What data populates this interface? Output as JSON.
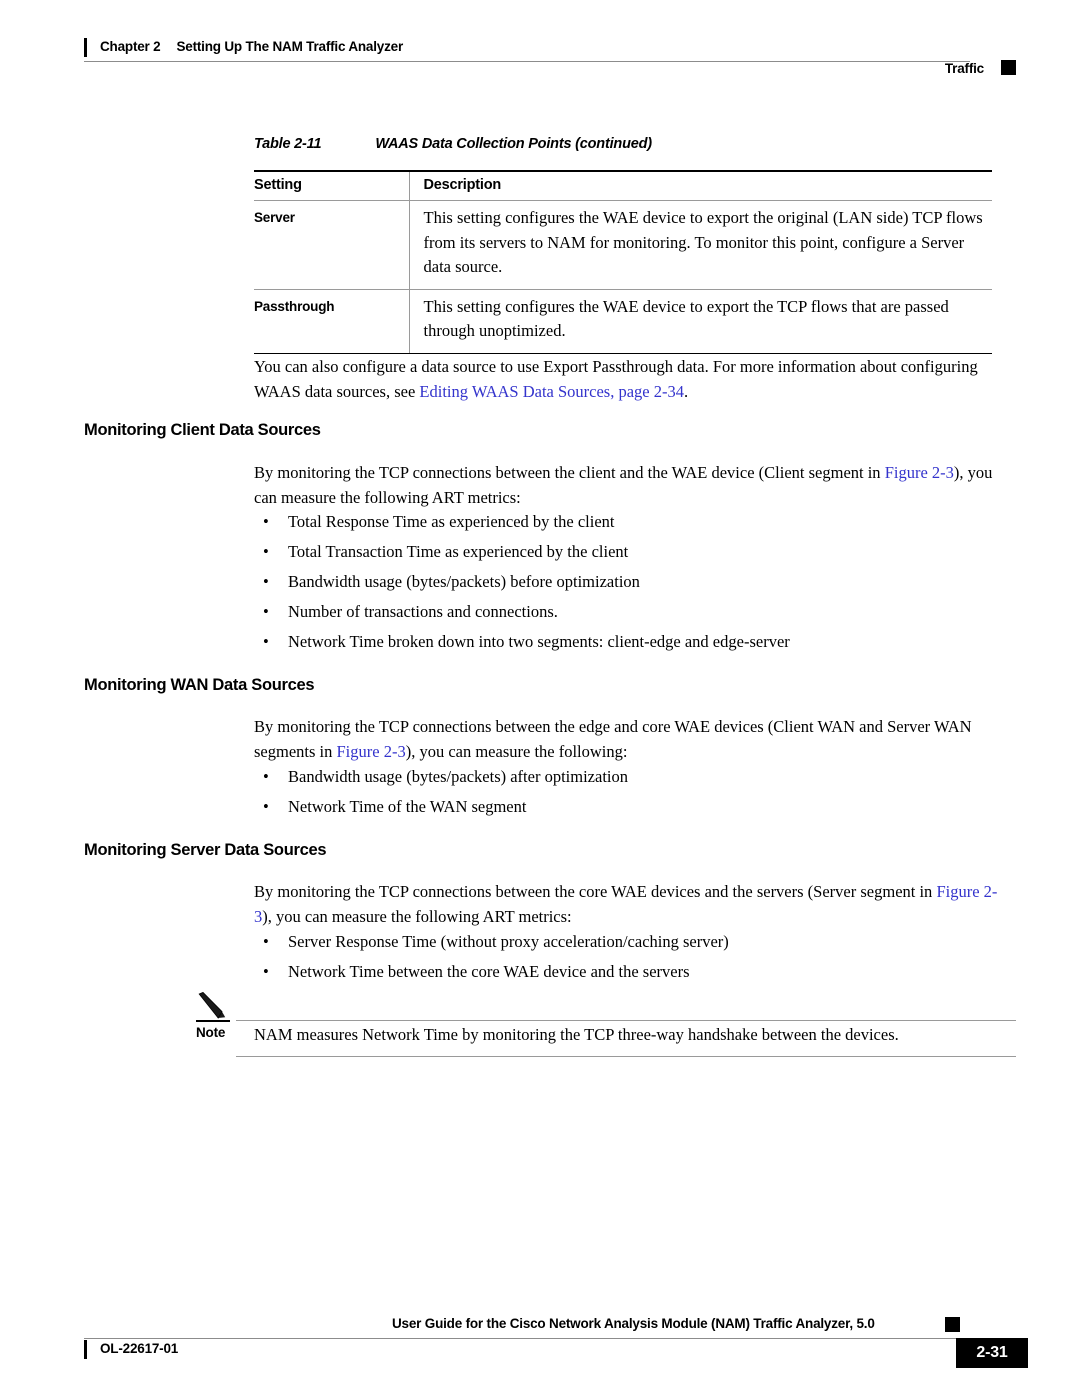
{
  "header": {
    "chapter": "Chapter 2",
    "chapter_title": "Setting Up The NAM Traffic Analyzer",
    "right_label": "Traffic"
  },
  "table": {
    "caption_number": "Table 2-11",
    "caption_title": "WAAS Data Collection Points  (continued)",
    "columns": [
      "Setting",
      "Description"
    ],
    "rows": [
      {
        "setting": "Server",
        "description": "This setting configures the WAE device to export the original (LAN side) TCP flows from its servers to NAM for monitoring. To monitor this point, configure a Server data source."
      },
      {
        "setting": "Passthrough",
        "description": "This setting configures the WAE device to export the TCP flows that are passed through unoptimized."
      }
    ]
  },
  "intro_para": {
    "text_before": "You can also configure a data source to use Export Passthrough data. For more information about configuring WAAS data sources, see ",
    "link": "Editing WAAS Data Sources, page 2-34",
    "text_after": "."
  },
  "sections": [
    {
      "heading": "Monitoring Client Data Sources",
      "para_before": "By monitoring the TCP connections between the client and the WAE device (Client segment in ",
      "para_link": "Figure 2-3",
      "para_after": "), you can measure the following ART metrics:",
      "bullets": [
        "Total Response Time as experienced by the client",
        "Total Transaction Time as experienced by the client",
        "Bandwidth usage (bytes/packets) before optimization",
        "Number of transactions and connections.",
        "Network Time broken down into two segments: client-edge and edge-server"
      ]
    },
    {
      "heading": "Monitoring WAN Data Sources",
      "para_before": "By monitoring the TCP connections between the edge and core WAE devices (Client WAN and Server WAN segments in ",
      "para_link": "Figure 2-3",
      "para_after": "), you can measure the following:",
      "bullets": [
        "Bandwidth usage (bytes/packets) after optimization",
        "Network Time of the WAN segment"
      ]
    },
    {
      "heading": "Monitoring Server Data Sources",
      "para_before": "By monitoring the TCP connections between the core WAE devices and the servers (Server segment in ",
      "para_link": "Figure 2-3",
      "para_after": "), you can measure the following ART metrics:",
      "bullets": [
        "Server Response Time (without proxy acceleration/caching server)",
        "Network Time between the core WAE device and the servers"
      ]
    }
  ],
  "note": {
    "label": "Note",
    "text": "NAM measures Network Time by monitoring the TCP three-way handshake between the devices."
  },
  "footer": {
    "title": "User Guide for the Cisco Network Analysis Module (NAM) Traffic Analyzer, 5.0",
    "doc_id": "OL-22617-01",
    "page_number": "2-31"
  },
  "colors": {
    "link": "#3333CC",
    "rule": "#9A9A9A",
    "text": "#000000"
  },
  "bullet_glyph": "•"
}
